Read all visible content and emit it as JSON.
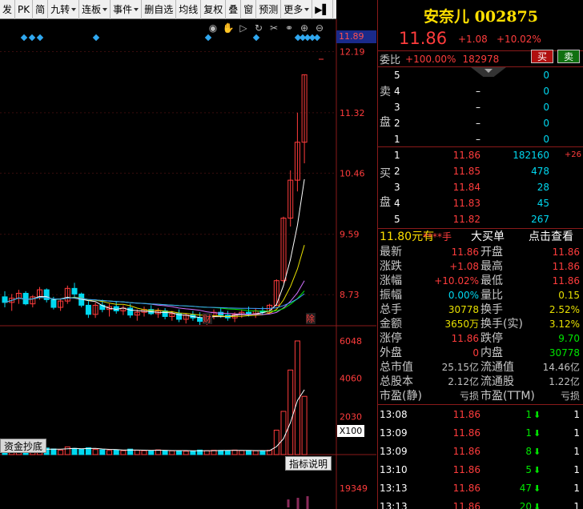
{
  "toolbar": {
    "items": [
      "发",
      "PK",
      "简",
      "九转",
      "连板",
      "事件",
      "删自选",
      "均线",
      "复权",
      "叠",
      "窗",
      "预测",
      "更多",
      "▶▌"
    ]
  },
  "chart": {
    "price_axis": [
      "12.19",
      "11.32",
      "10.46",
      "9.59",
      "8.73"
    ],
    "current_price_tag": "11.89",
    "volume_axis": [
      "6048",
      "4060",
      "2030"
    ],
    "volume_unit": "X100",
    "indicator_axis": "19349",
    "markers": [
      "财",
      "除"
    ],
    "indicator_tab": "资金抄底",
    "indicator_help": "指标说明",
    "tools": [
      "eye-icon",
      "hand-icon",
      "play-icon",
      "refresh-icon",
      "scissors-icon",
      "link-icon",
      "zoom-in-icon",
      "zoom-out-icon"
    ]
  },
  "chart_data": {
    "type": "candlestick",
    "ylim": [
      8.3,
      12.4
    ],
    "candles": [
      [
        8.7,
        8.78,
        8.55,
        8.62
      ],
      [
        8.62,
        8.74,
        8.5,
        8.68
      ],
      [
        8.68,
        8.8,
        8.6,
        8.75
      ],
      [
        8.75,
        8.78,
        8.58,
        8.6
      ],
      [
        8.6,
        8.72,
        8.55,
        8.7
      ],
      [
        8.7,
        8.84,
        8.66,
        8.8
      ],
      [
        8.8,
        8.82,
        8.62,
        8.66
      ],
      [
        8.66,
        8.7,
        8.52,
        8.55
      ],
      [
        8.55,
        8.68,
        8.5,
        8.64
      ],
      [
        8.64,
        8.86,
        8.6,
        8.82
      ],
      [
        8.82,
        8.9,
        8.7,
        8.74
      ],
      [
        8.74,
        8.76,
        8.55,
        8.58
      ],
      [
        8.58,
        8.64,
        8.4,
        8.45
      ],
      [
        8.45,
        8.62,
        8.4,
        8.58
      ],
      [
        8.58,
        8.66,
        8.48,
        8.52
      ],
      [
        8.52,
        8.6,
        8.42,
        8.56
      ],
      [
        8.56,
        8.64,
        8.46,
        8.5
      ],
      [
        8.5,
        8.58,
        8.44,
        8.54
      ],
      [
        8.54,
        8.6,
        8.4,
        8.44
      ],
      [
        8.44,
        8.52,
        8.36,
        8.48
      ],
      [
        8.48,
        8.56,
        8.42,
        8.52
      ],
      [
        8.52,
        8.58,
        8.44,
        8.46
      ],
      [
        8.46,
        8.54,
        8.4,
        8.5
      ],
      [
        8.5,
        8.54,
        8.38,
        8.42
      ],
      [
        8.42,
        8.5,
        8.36,
        8.46
      ],
      [
        8.46,
        8.52,
        8.34,
        8.38
      ],
      [
        8.38,
        8.46,
        8.32,
        8.44
      ],
      [
        8.44,
        8.5,
        8.36,
        8.4
      ],
      [
        8.4,
        8.48,
        8.3,
        8.35
      ],
      [
        8.35,
        8.46,
        8.3,
        8.42
      ],
      [
        8.42,
        8.52,
        8.38,
        8.48
      ],
      [
        8.48,
        8.54,
        8.4,
        8.44
      ],
      [
        8.44,
        8.5,
        8.36,
        8.4
      ],
      [
        8.4,
        8.48,
        8.34,
        8.45
      ],
      [
        8.45,
        8.52,
        8.4,
        8.48
      ],
      [
        8.48,
        8.56,
        8.42,
        8.46
      ],
      [
        8.46,
        8.54,
        8.4,
        8.5
      ],
      [
        8.5,
        8.56,
        8.44,
        8.48
      ],
      [
        8.48,
        8.6,
        8.46,
        8.58
      ],
      [
        8.58,
        8.95,
        8.56,
        8.93
      ],
      [
        8.93,
        9.84,
        8.9,
        9.82
      ],
      [
        9.82,
        10.5,
        9.7,
        10.36
      ],
      [
        10.36,
        11.32,
        10.2,
        10.9
      ],
      [
        10.9,
        11.86,
        10.6,
        11.86
      ]
    ],
    "volumes": [
      380,
      240,
      310,
      220,
      290,
      260,
      350,
      300,
      240,
      410,
      330,
      280,
      360,
      270,
      250,
      220,
      240,
      210,
      290,
      230,
      210,
      190,
      250,
      220,
      200,
      210,
      180,
      190,
      240,
      210,
      230,
      220,
      200,
      240,
      210,
      220,
      200,
      190,
      230,
      1300,
      2300,
      4500,
      6048,
      3100
    ],
    "ma_series": [
      {
        "color": "#ffffff"
      },
      {
        "color": "#e8e000"
      },
      {
        "color": "#d070ff"
      },
      {
        "color": "#00e600"
      },
      {
        "color": "#40a0ff"
      }
    ]
  },
  "panel": {
    "name": "安奈儿 002875",
    "price": "11.86",
    "change": "+1.08",
    "change_pct": "+10.02%",
    "weibi_label": "委比",
    "weibi_value": "+100.00%",
    "weicha": "182978",
    "buy_btn": "买",
    "sell_btn": "卖",
    "ask_label": [
      "卖",
      "盘"
    ],
    "bid_label": [
      "买",
      "盘"
    ],
    "asks": [
      {
        "level": "5",
        "price": "",
        "vol": "0"
      },
      {
        "level": "4",
        "price": "–",
        "vol": "0"
      },
      {
        "level": "3",
        "price": "–",
        "vol": "0"
      },
      {
        "level": "2",
        "price": "–",
        "vol": "0"
      },
      {
        "level": "1",
        "price": "–",
        "vol": "0"
      }
    ],
    "bids": [
      {
        "level": "1",
        "price": "11.86",
        "vol": "182160",
        "delta": "+26"
      },
      {
        "level": "2",
        "price": "11.85",
        "vol": "478",
        "delta": ""
      },
      {
        "level": "3",
        "price": "11.84",
        "vol": "28",
        "delta": ""
      },
      {
        "level": "4",
        "price": "11.83",
        "vol": "45",
        "delta": ""
      },
      {
        "level": "5",
        "price": "11.82",
        "vol": "267",
        "delta": ""
      }
    ],
    "big_order": {
      "a": "11.80元有",
      "b": "****手",
      "c": "大买单",
      "d": "点击查看"
    },
    "stats": [
      {
        "l1": "最新",
        "v1": "11.86",
        "c1": "red",
        "l2": "开盘",
        "v2": "11.86",
        "c2": "red"
      },
      {
        "l1": "涨跌",
        "v1": "+1.08",
        "c1": "red",
        "l2": "最高",
        "v2": "11.86",
        "c2": "red"
      },
      {
        "l1": "涨幅",
        "v1": "+10.02%",
        "c1": "red",
        "l2": "最低",
        "v2": "11.86",
        "c2": "red"
      },
      {
        "l1": "振幅",
        "v1": "0.00%",
        "c1": "cyan",
        "l2": "量比",
        "v2": "0.15",
        "c2": "yellow"
      },
      {
        "l1": "总手",
        "v1": "30778",
        "c1": "yellow",
        "l2": "换手",
        "v2": "2.52%",
        "c2": "yellow"
      },
      {
        "l1": "金额",
        "v1": "3650万",
        "c1": "yellow",
        "l2": "换手(实)",
        "v2": "3.12%",
        "c2": "yellow"
      },
      {
        "l1": "涨停",
        "v1": "11.86",
        "c1": "red",
        "l2": "跌停",
        "v2": "9.70",
        "c2": "green"
      },
      {
        "l1": "外盘",
        "v1": "0",
        "c1": "red",
        "l2": "内盘",
        "v2": "30778",
        "c2": "green"
      },
      {
        "l1": "总市值",
        "v1": "25.15亿",
        "c1": "gray",
        "l2": "流通值",
        "v2": "14.46亿",
        "c2": "gray"
      },
      {
        "l1": "总股本",
        "v1": "2.12亿",
        "c1": "gray",
        "l2": "流通股",
        "v2": "1.22亿",
        "c2": "gray"
      },
      {
        "l1": "市盈(静)",
        "v1": "亏损",
        "c1": "gray",
        "l2": "市盈(TTM)",
        "v2": "亏损",
        "c2": "gray"
      }
    ],
    "ticks": [
      {
        "time": "13:08",
        "price": "11.86",
        "vol": "1",
        "num": "1"
      },
      {
        "time": "13:09",
        "price": "11.86",
        "vol": "1",
        "num": "1"
      },
      {
        "time": "13:09",
        "price": "11.86",
        "vol": "8",
        "num": "1"
      },
      {
        "time": "13:10",
        "price": "11.86",
        "vol": "5",
        "num": "1"
      },
      {
        "time": "13:13",
        "price": "11.86",
        "vol": "47",
        "num": "1"
      },
      {
        "time": "13:13",
        "price": "11.86",
        "vol": "20",
        "num": "1"
      }
    ]
  }
}
